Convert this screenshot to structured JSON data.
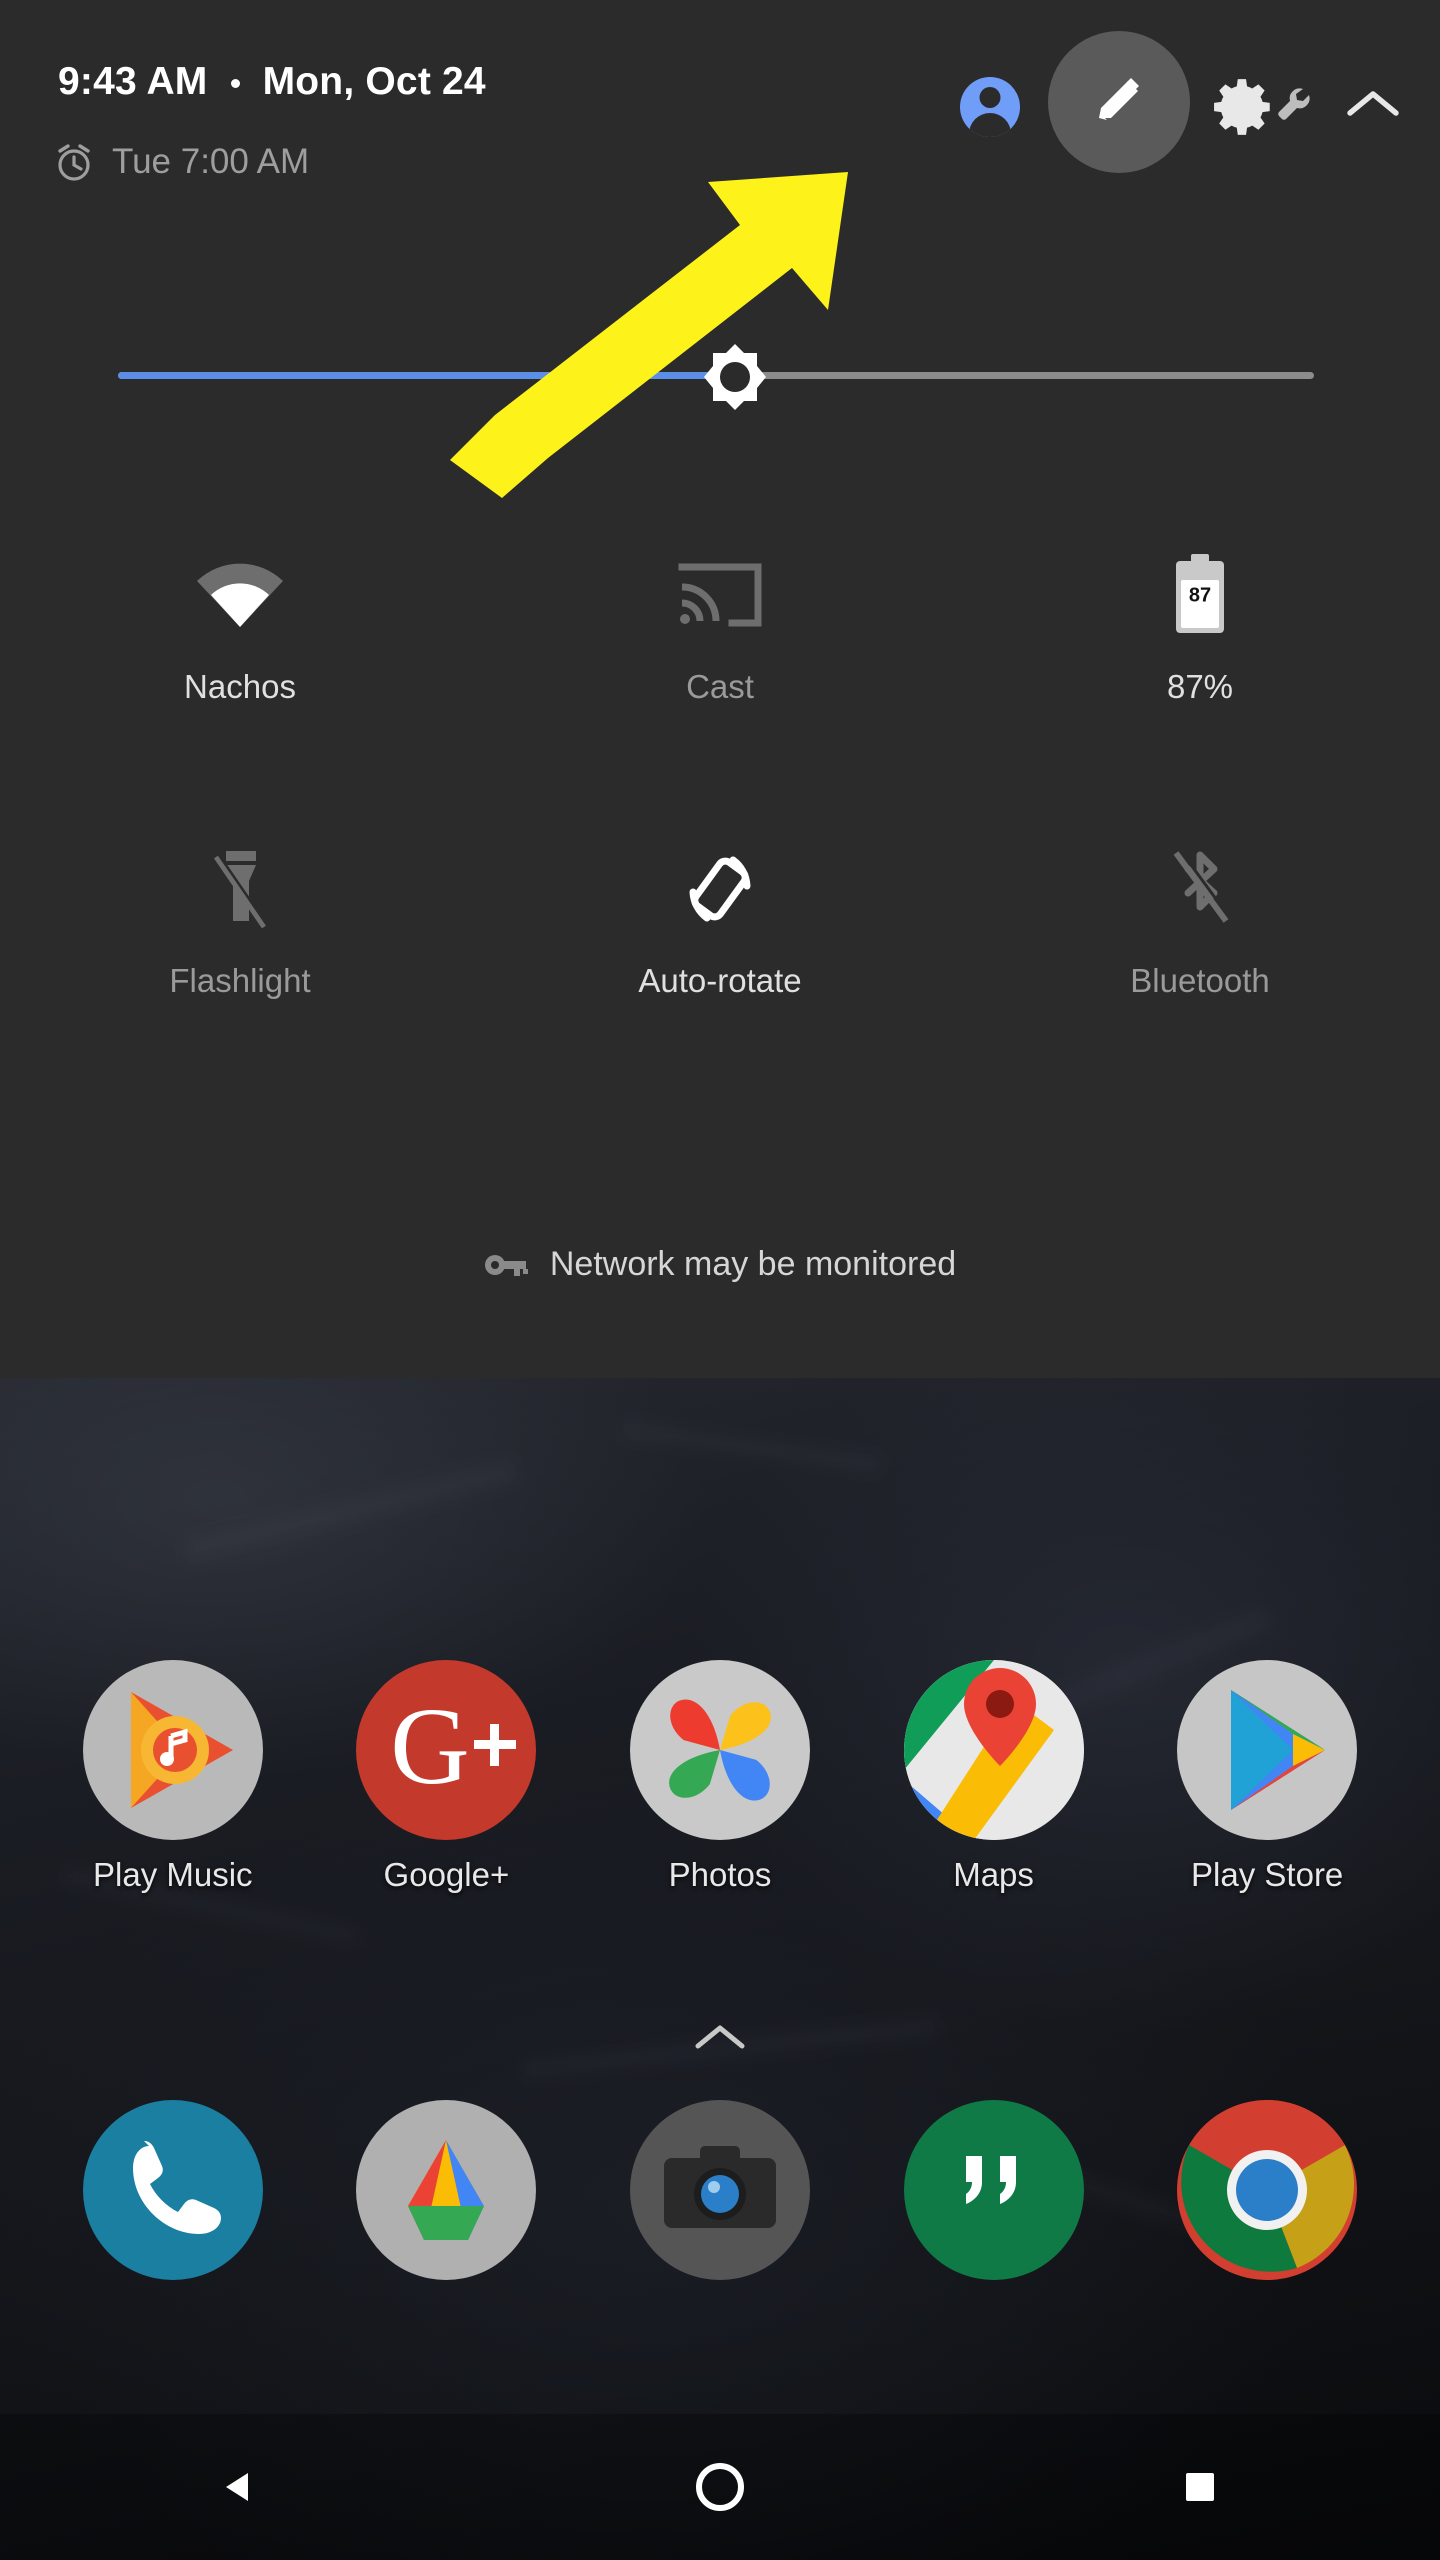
{
  "statusbar": {
    "time": "9:43 AM",
    "date": "Mon, Oct 24",
    "alarm": "Tue 7:00 AM",
    "alarm_icon": "alarm-clock-icon"
  },
  "header_actions": {
    "avatar": "user-avatar",
    "edit": "edit-pencil-icon",
    "settings": "settings-gear-icon",
    "wrench": "wrench-icon",
    "collapse": "chevron-up-icon"
  },
  "brightness": {
    "label": "Brightness",
    "value": 49,
    "fill_color": "#5b8ee6",
    "track_color": "#8c8c8c",
    "thumb_icon": "brightness-sun-icon"
  },
  "tiles": [
    [
      {
        "name": "wifi",
        "label": "Nachos",
        "icon": "wifi-icon",
        "state": "on"
      },
      {
        "name": "cast",
        "label": "Cast",
        "icon": "cast-icon",
        "state": "off"
      },
      {
        "name": "battery",
        "label": "87%",
        "icon": "battery-icon",
        "state": "on",
        "battery_level": "87"
      }
    ],
    [
      {
        "name": "flashlight",
        "label": "Flashlight",
        "icon": "flashlight-off-icon",
        "state": "off"
      },
      {
        "name": "auto-rotate",
        "label": "Auto-rotate",
        "icon": "auto-rotate-icon",
        "state": "on"
      },
      {
        "name": "bluetooth",
        "label": "Bluetooth",
        "icon": "bluetooth-off-icon",
        "state": "off"
      }
    ]
  ],
  "footer": {
    "icon": "key-icon",
    "text": "Network may be monitored"
  },
  "annotation": {
    "type": "arrow",
    "color": "#fdf21a",
    "points_to": "edit-pencil-icon"
  },
  "home": {
    "app_rows": [
      [
        {
          "name": "play-music",
          "label": "Play Music"
        },
        {
          "name": "google-plus",
          "label": "Google+"
        },
        {
          "name": "photos",
          "label": "Photos"
        },
        {
          "name": "maps",
          "label": "Maps"
        },
        {
          "name": "play-store",
          "label": "Play Store"
        }
      ]
    ],
    "all_apps_icon": "chevron-up-icon",
    "dock": [
      {
        "name": "phone",
        "label": "Phone"
      },
      {
        "name": "drive",
        "label": "Drive"
      },
      {
        "name": "camera",
        "label": "Camera"
      },
      {
        "name": "hangouts",
        "label": "Hangouts"
      },
      {
        "name": "chrome",
        "label": "Chrome"
      }
    ]
  },
  "navbar": {
    "back": "back-triangle-icon",
    "home": "home-circle-icon",
    "recents": "recents-square-icon"
  },
  "colors": {
    "panel_bg": "#2b2b2b",
    "accent_blue": "#5b8ee6",
    "avatar_blue": "#6f9df8",
    "highlight_gray": "#5a5a5a",
    "annotation_yellow": "#fdf21a"
  }
}
